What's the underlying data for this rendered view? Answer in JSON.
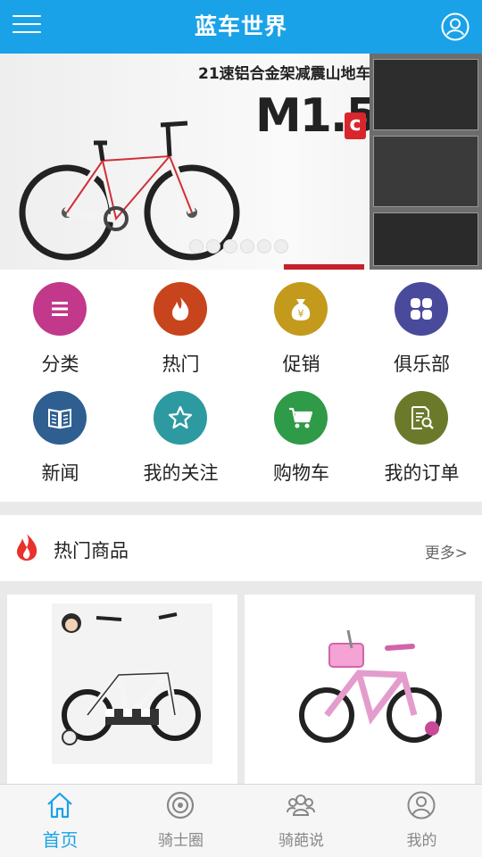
{
  "header": {
    "title": "蓝车世界"
  },
  "banner": {
    "heading": "21速铝合金架减震山地车",
    "model": "M1.5",
    "model_suffix": "c",
    "slide_count": 6
  },
  "categories": [
    {
      "label": "分类",
      "icon": "list-icon",
      "color": "#c2388a"
    },
    {
      "label": "热门",
      "icon": "flame-icon",
      "color": "#c8441c"
    },
    {
      "label": "促销",
      "icon": "money-bag-icon",
      "color": "#c39a1b"
    },
    {
      "label": "俱乐部",
      "icon": "grid-icon",
      "color": "#4a4a9c"
    },
    {
      "label": "新闻",
      "icon": "book-icon",
      "color": "#2f5f90"
    },
    {
      "label": "我的关注",
      "icon": "star-icon",
      "color": "#2c9aa0"
    },
    {
      "label": "购物车",
      "icon": "cart-icon",
      "color": "#2f9a47"
    },
    {
      "label": "我的订单",
      "icon": "order-search-icon",
      "color": "#6b7a2a"
    }
  ],
  "hot": {
    "title": "热门商品",
    "more": "更多>"
  },
  "tabs": [
    {
      "label": "首页",
      "icon": "home-icon",
      "active": true
    },
    {
      "label": "骑士圈",
      "icon": "target-icon",
      "active": false
    },
    {
      "label": "骑葩说",
      "icon": "group-icon",
      "active": false
    },
    {
      "label": "我的",
      "icon": "user-icon",
      "active": false
    }
  ],
  "colors": {
    "primary": "#1aa2e8",
    "accent_red": "#d8262c"
  }
}
